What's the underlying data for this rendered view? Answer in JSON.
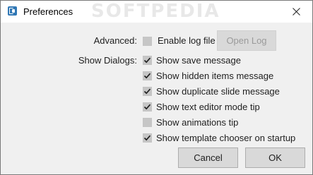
{
  "window": {
    "title": "Preferences",
    "icon": "app-icon",
    "close_icon": "close-icon"
  },
  "watermark": "SOFTPEDIA",
  "advanced": {
    "label": "Advanced:",
    "enable_log": {
      "label": "Enable log file",
      "checked": false
    },
    "open_log_button": {
      "label": "Open Log",
      "enabled": false
    }
  },
  "show_dialogs": {
    "label": "Show Dialogs:",
    "options": [
      {
        "label": "Show save message",
        "checked": true
      },
      {
        "label": "Show hidden items message",
        "checked": true
      },
      {
        "label": "Show duplicate slide message",
        "checked": true
      },
      {
        "label": "Show text editor mode tip",
        "checked": true
      },
      {
        "label": "Show animations tip",
        "checked": false
      },
      {
        "label": "Show template chooser on startup",
        "checked": true
      }
    ]
  },
  "buttons": {
    "cancel": "Cancel",
    "ok": "OK"
  },
  "colors": {
    "window_bg": "#f0f0f0",
    "checkbox_bg": "#c6c6c6",
    "button_bg": "#d9d9d9",
    "text": "#1e1e1e"
  }
}
